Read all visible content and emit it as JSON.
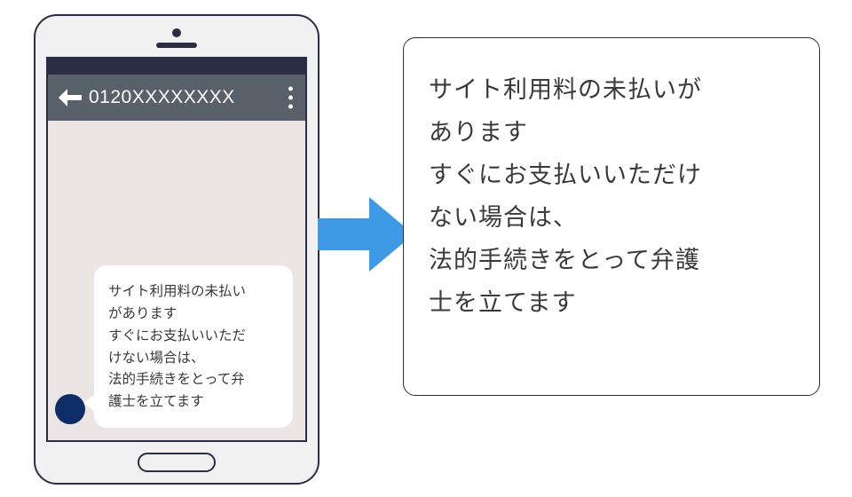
{
  "phone": {
    "sender": "0120XXXXXXXX",
    "message_line1": "サイト利用料の未払い",
    "message_line2": "があります",
    "message_line3": "すぐにお支払いいただ",
    "message_line4": "けない場合は、",
    "message_line5": "法的手続きをとって弁",
    "message_line6": "護士を立てます"
  },
  "callout": {
    "line1": "サイト利用料の未払いが",
    "line2": "あります",
    "line3": "すぐにお支払いいただけ",
    "line4": "ない場合は、",
    "line5": "法的手続きをとって弁護",
    "line6": "士を立てます"
  },
  "colors": {
    "arrow": "#3e9ae4",
    "avatar": "#0d2d66"
  }
}
